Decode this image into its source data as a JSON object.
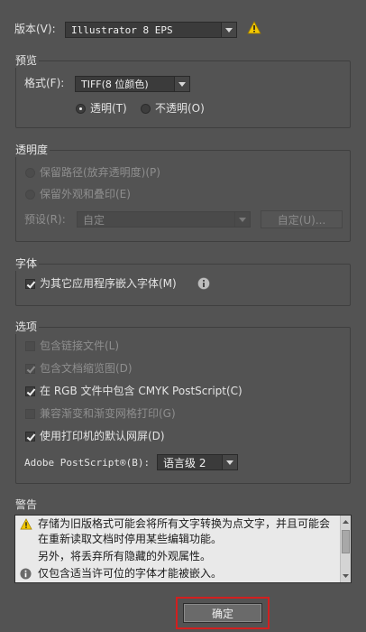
{
  "version": {
    "label": "版本(V):",
    "value": "Illustrator 8 EPS",
    "warning_icon": "warning-triangle-icon"
  },
  "preview": {
    "title": "预览",
    "format_label": "格式(F):",
    "format_value": "TIFF(8 位颜色)",
    "transparent_label": "透明(T)",
    "opaque_label": "不透明(O)",
    "selected": "transparent"
  },
  "transparency": {
    "title": "透明度",
    "preserve_paths": "保留路径(放弃透明度)(P)",
    "preserve_appearance": "保留外观和叠印(E)",
    "preset_label": "预设(R):",
    "preset_value": "自定",
    "custom_button": "自定(U)..."
  },
  "fonts": {
    "title": "字体",
    "embed_label": "为其它应用程序嵌入字体(M)",
    "embed_checked": true,
    "info_icon": "info-icon"
  },
  "options": {
    "title": "选项",
    "items": [
      {
        "label": "包含链接文件(L)",
        "checked": false,
        "enabled": false
      },
      {
        "label": "包含文档缩览图(D)",
        "checked": true,
        "enabled": false
      },
      {
        "label": "在 RGB 文件中包含 CMYK PostScript(C)",
        "checked": true,
        "enabled": true
      },
      {
        "label": "兼容渐变和渐变网格打印(G)",
        "checked": false,
        "enabled": false
      },
      {
        "label": "使用打印机的默认网屏(D)",
        "checked": true,
        "enabled": true
      }
    ],
    "postscript_label": "Adobe PostScript®(B):",
    "postscript_value": "语言级 2"
  },
  "warnings": {
    "title": "警告",
    "lines": [
      "存储为旧版格式可能会将所有文字转换为点文字，并且可能会",
      "在重新读取文档时停用某些编辑功能。",
      "另外，将丢弃所有隐藏的外观属性。",
      "仅包含适当许可位的字体才能被嵌入。"
    ]
  },
  "ok_button": "确定",
  "colors": {
    "background": "#535353",
    "warning": "#f3c800",
    "highlight": "#d21f1f"
  }
}
